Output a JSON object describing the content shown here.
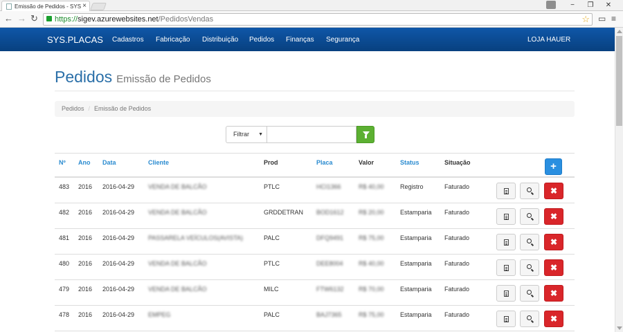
{
  "browser": {
    "tab_title": "Emissão de Pedidos - SYS",
    "url_scheme": "https://",
    "url_host": "sigev.azurewebsites.net",
    "url_path": "/PedidosVendas",
    "win_minimize": "−",
    "win_restore": "❐",
    "win_close": "✕"
  },
  "nav": {
    "brand": "SYS.PLACAS",
    "items": [
      "Cadastros",
      "Fabricação",
      "Distribuição",
      "Pedidos",
      "Finanças",
      "Segurança"
    ],
    "store": "LOJA HAUER"
  },
  "page": {
    "title": "Pedidos",
    "subtitle": "Emissão de Pedidos"
  },
  "breadcrumb": [
    "Pedidos",
    "Emissão de Pedidos"
  ],
  "filter": {
    "select_label": "Filtrar",
    "input_value": ""
  },
  "table": {
    "headers": [
      "Nº",
      "Ano",
      "Data",
      "Cliente",
      "Prod",
      "Placa",
      "Valor",
      "Status",
      "Situação"
    ],
    "add_label": "+",
    "rows": [
      {
        "num": "483",
        "ano": "2016",
        "data": "2016-04-29",
        "cliente": "VENDA DE BALCÃO",
        "prod": "PTLC",
        "placa": "HCI1366",
        "valor": "R$ 40,00",
        "status": "Registro",
        "situacao": "Faturado"
      },
      {
        "num": "482",
        "ano": "2016",
        "data": "2016-04-29",
        "cliente": "VENDA DE BALCÃO",
        "prod": "GRDDETRAN",
        "placa": "BOD1612",
        "valor": "R$ 20,00",
        "status": "Estamparia",
        "situacao": "Faturado"
      },
      {
        "num": "481",
        "ano": "2016",
        "data": "2016-04-29",
        "cliente": "PASSARELA VEÍCULOS(AVISTA)",
        "prod": "PALC",
        "placa": "DFQ9491",
        "valor": "R$ 75,00",
        "status": "Estamparia",
        "situacao": "Faturado"
      },
      {
        "num": "480",
        "ano": "2016",
        "data": "2016-04-29",
        "cliente": "VENDA DE BALCÃO",
        "prod": "PTLC",
        "placa": "DEE8004",
        "valor": "R$ 40,00",
        "status": "Estamparia",
        "situacao": "Faturado"
      },
      {
        "num": "479",
        "ano": "2016",
        "data": "2016-04-29",
        "cliente": "VENDA DE BALCÃO",
        "prod": "MILC",
        "placa": "FTW6132",
        "valor": "R$ 70,00",
        "status": "Estamparia",
        "situacao": "Faturado"
      },
      {
        "num": "478",
        "ano": "2016",
        "data": "2016-04-29",
        "cliente": "EMPEG",
        "prod": "PALC",
        "placa": "BAJ7365",
        "valor": "R$ 75,00",
        "status": "Estamparia",
        "situacao": "Faturado"
      }
    ]
  }
}
